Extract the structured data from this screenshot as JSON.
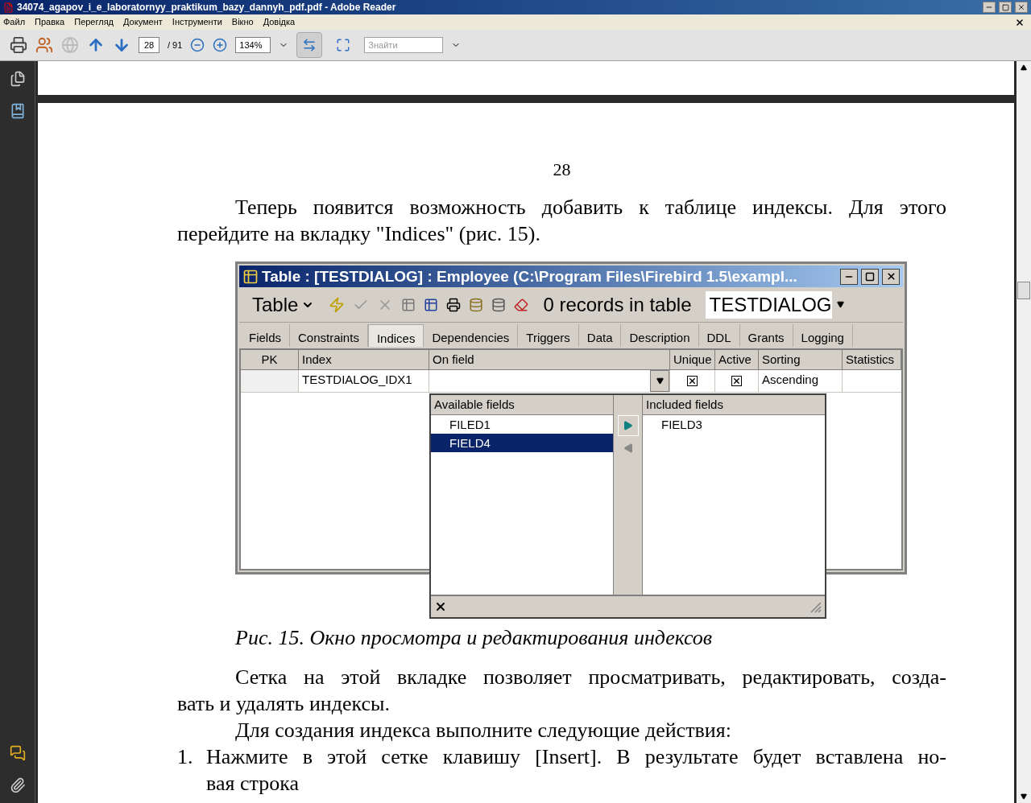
{
  "window": {
    "title": "34074_agapov_i_e_laboratornyy_praktikum_bazy_dannyh_pdf.pdf - Adobe Reader"
  },
  "menu": [
    "Файл",
    "Правка",
    "Перегляд",
    "Документ",
    "Інструменти",
    "Вікно",
    "Довідка"
  ],
  "toolbar": {
    "page": "28",
    "page_total": "/ 91",
    "zoom": "134%",
    "search_placeholder": "Знайти",
    "view_buttons": [
      {
        "kind": "fit-width",
        "selected": true
      },
      {
        "kind": "fit-page",
        "selected": false
      }
    ]
  },
  "document": {
    "page_number": "28",
    "intro": [
      {
        "text": "Теперь появится возможность добавить к таблице индексы. Для этого",
        "indent": true,
        "justify": true
      },
      {
        "text": "перейдите на вкладку \"Indices\" (рис. 15).",
        "indent": false,
        "justify": false
      }
    ],
    "figure": {
      "title": "Table : [TESTDIALOG] : Employee (C:\\Program Files\\Firebird 1.5\\exampl...",
      "table_button": "Table",
      "records": "0 records in table",
      "table_combo": "TESTDIALOG",
      "tabs": [
        {
          "label": "Fields",
          "selected": false
        },
        {
          "label": "Constraints",
          "selected": false
        },
        {
          "label": "Indices",
          "selected": true
        },
        {
          "label": "Dependencies",
          "selected": false
        },
        {
          "label": "Triggers",
          "selected": false
        },
        {
          "label": "Data",
          "selected": false
        },
        {
          "label": "Description",
          "selected": false
        },
        {
          "label": "DDL",
          "selected": false
        },
        {
          "label": "Grants",
          "selected": false
        },
        {
          "label": "Logging",
          "selected": false
        }
      ],
      "columns": [
        "PK",
        "Index",
        "On field",
        "Unique",
        "Active",
        "Sorting",
        "Statistics"
      ],
      "rows": [
        {
          "index": "TESTDIALOG_IDX1",
          "unique": true,
          "active": true,
          "sorting": "Ascending"
        }
      ],
      "picker": {
        "available_header": "Available fields",
        "included_header": "Included fields",
        "available": [
          {
            "label": "FILED1",
            "selected": false
          },
          {
            "label": "FIELD4",
            "selected": true
          }
        ],
        "included": [
          {
            "label": "FIELD3",
            "selected": false
          }
        ]
      }
    },
    "caption": "Рис. 15. Окно просмотра и редактирования индексов",
    "body": [
      {
        "text": "Сетка на этой вкладке позволяет просматривать, редактировать, созда-",
        "indent": true,
        "justify": true
      },
      {
        "text": "вать и удалять индексы.",
        "indent": false,
        "justify": false
      },
      {
        "text": "Для создания индекса выполните следующие действия:",
        "indent": true,
        "justify": false
      }
    ],
    "list": [
      {
        "number": "1.",
        "lines": [
          "Нажмите в этой сетке клавишу [Insert]. В результате будет вставлена но-",
          "вая строка"
        ]
      }
    ]
  }
}
